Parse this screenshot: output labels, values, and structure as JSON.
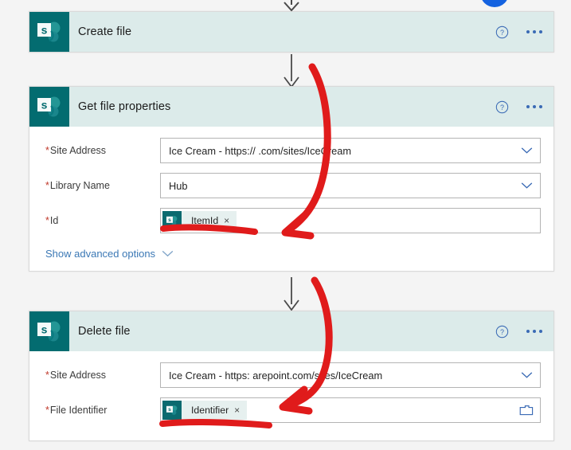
{
  "app": {
    "surface": "power-automate-flow-designer",
    "background_color": "#f4f4f4",
    "accent_color": "#3b78b5",
    "connector_brand_color": "#036c70",
    "annotation_color": "#e01b1b"
  },
  "top_marker": {
    "name": "blue-circle-marker",
    "color": "#1462e0"
  },
  "icons": {
    "sharepoint": "sharepoint-icon",
    "help": "help-circle-icon",
    "more": "ellipsis-icon",
    "chevron": "chevron-down-icon",
    "folder": "folder-browse-icon",
    "remove_token": "close-icon",
    "flow_arrow": "down-arrow-icon"
  },
  "cards": [
    {
      "id": "create-file",
      "title": "Create file",
      "collapsed": true,
      "help_label": "?",
      "fields": []
    },
    {
      "id": "get-file-properties",
      "title": "Get file properties",
      "collapsed": false,
      "help_label": "?",
      "fields": [
        {
          "name": "site-address",
          "label": "Site Address",
          "required": true,
          "type": "dropdown",
          "value": "Ice Cream - https://             .com/sites/IceCream"
        },
        {
          "name": "library-name",
          "label": "Library Name",
          "required": true,
          "type": "dropdown",
          "value": "Hub"
        },
        {
          "name": "id",
          "label": "Id",
          "required": true,
          "type": "token",
          "token": {
            "label": "ItemId",
            "remove": "×"
          }
        }
      ],
      "advanced_options_label": "Show advanced options"
    },
    {
      "id": "delete-file",
      "title": "Delete file",
      "collapsed": false,
      "help_label": "?",
      "fields": [
        {
          "name": "site-address",
          "label": "Site Address",
          "required": true,
          "type": "dropdown",
          "value": "Ice Cream - https:             arepoint.com/sites/IceCream"
        },
        {
          "name": "file-identifier",
          "label": "File Identifier",
          "required": true,
          "type": "token-with-picker",
          "token": {
            "label": "Identifier",
            "remove": "×"
          }
        }
      ]
    }
  ],
  "annotations": {
    "color": "#e01b1b",
    "shapes": [
      {
        "name": "arrow-to-id-field",
        "kind": "curved-arrow"
      },
      {
        "name": "underline-id-field",
        "kind": "underline"
      },
      {
        "name": "arrow-to-file-identifier-field",
        "kind": "curved-arrow"
      },
      {
        "name": "underline-file-identifier-field",
        "kind": "underline"
      }
    ]
  }
}
